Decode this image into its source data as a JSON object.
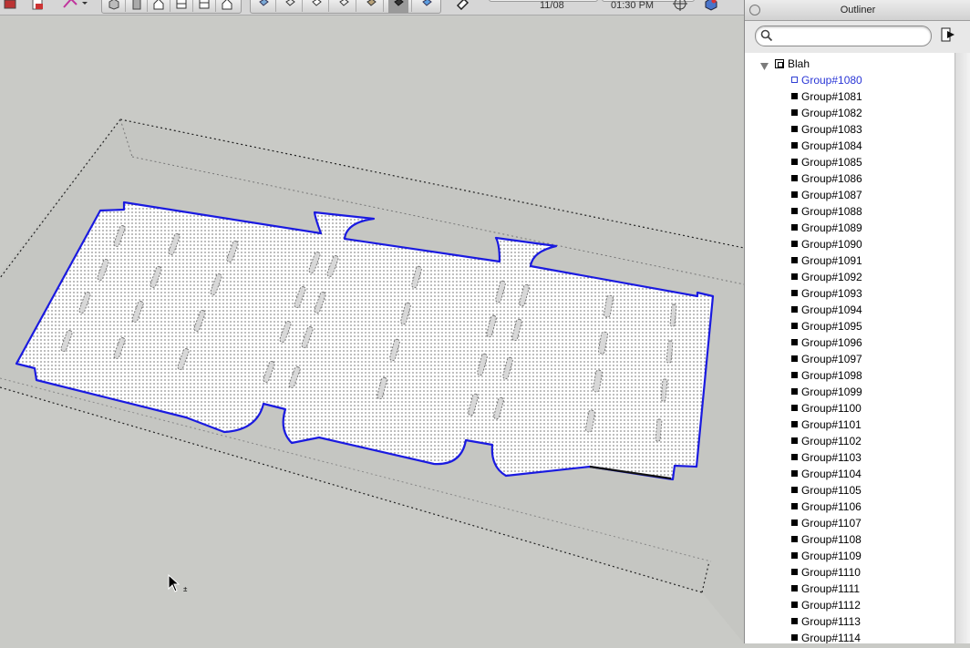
{
  "toolbar": {
    "date": "11/08",
    "time": "01:30 PM"
  },
  "outliner": {
    "title": "Outliner",
    "search_placeholder": "",
    "root_label": "Blah",
    "groups": [
      "Group#1080",
      "Group#1081",
      "Group#1082",
      "Group#1083",
      "Group#1084",
      "Group#1085",
      "Group#1086",
      "Group#1087",
      "Group#1088",
      "Group#1089",
      "Group#1090",
      "Group#1091",
      "Group#1092",
      "Group#1093",
      "Group#1094",
      "Group#1095",
      "Group#1096",
      "Group#1097",
      "Group#1098",
      "Group#1099",
      "Group#1100",
      "Group#1101",
      "Group#1102",
      "Group#1103",
      "Group#1104",
      "Group#1105",
      "Group#1106",
      "Group#1107",
      "Group#1108",
      "Group#1109",
      "Group#1110",
      "Group#1111",
      "Group#1112",
      "Group#1113",
      "Group#1114"
    ],
    "selected_group": "Group#1080"
  },
  "colors": {
    "viewport_bg": "#c9cac6",
    "selection_blue": "#1a1ae0"
  },
  "icons": {
    "close": "close-icon",
    "search": "search-icon",
    "export": "export-icon",
    "tree_toggle": "triangle-down-icon",
    "component": "component-icon"
  }
}
